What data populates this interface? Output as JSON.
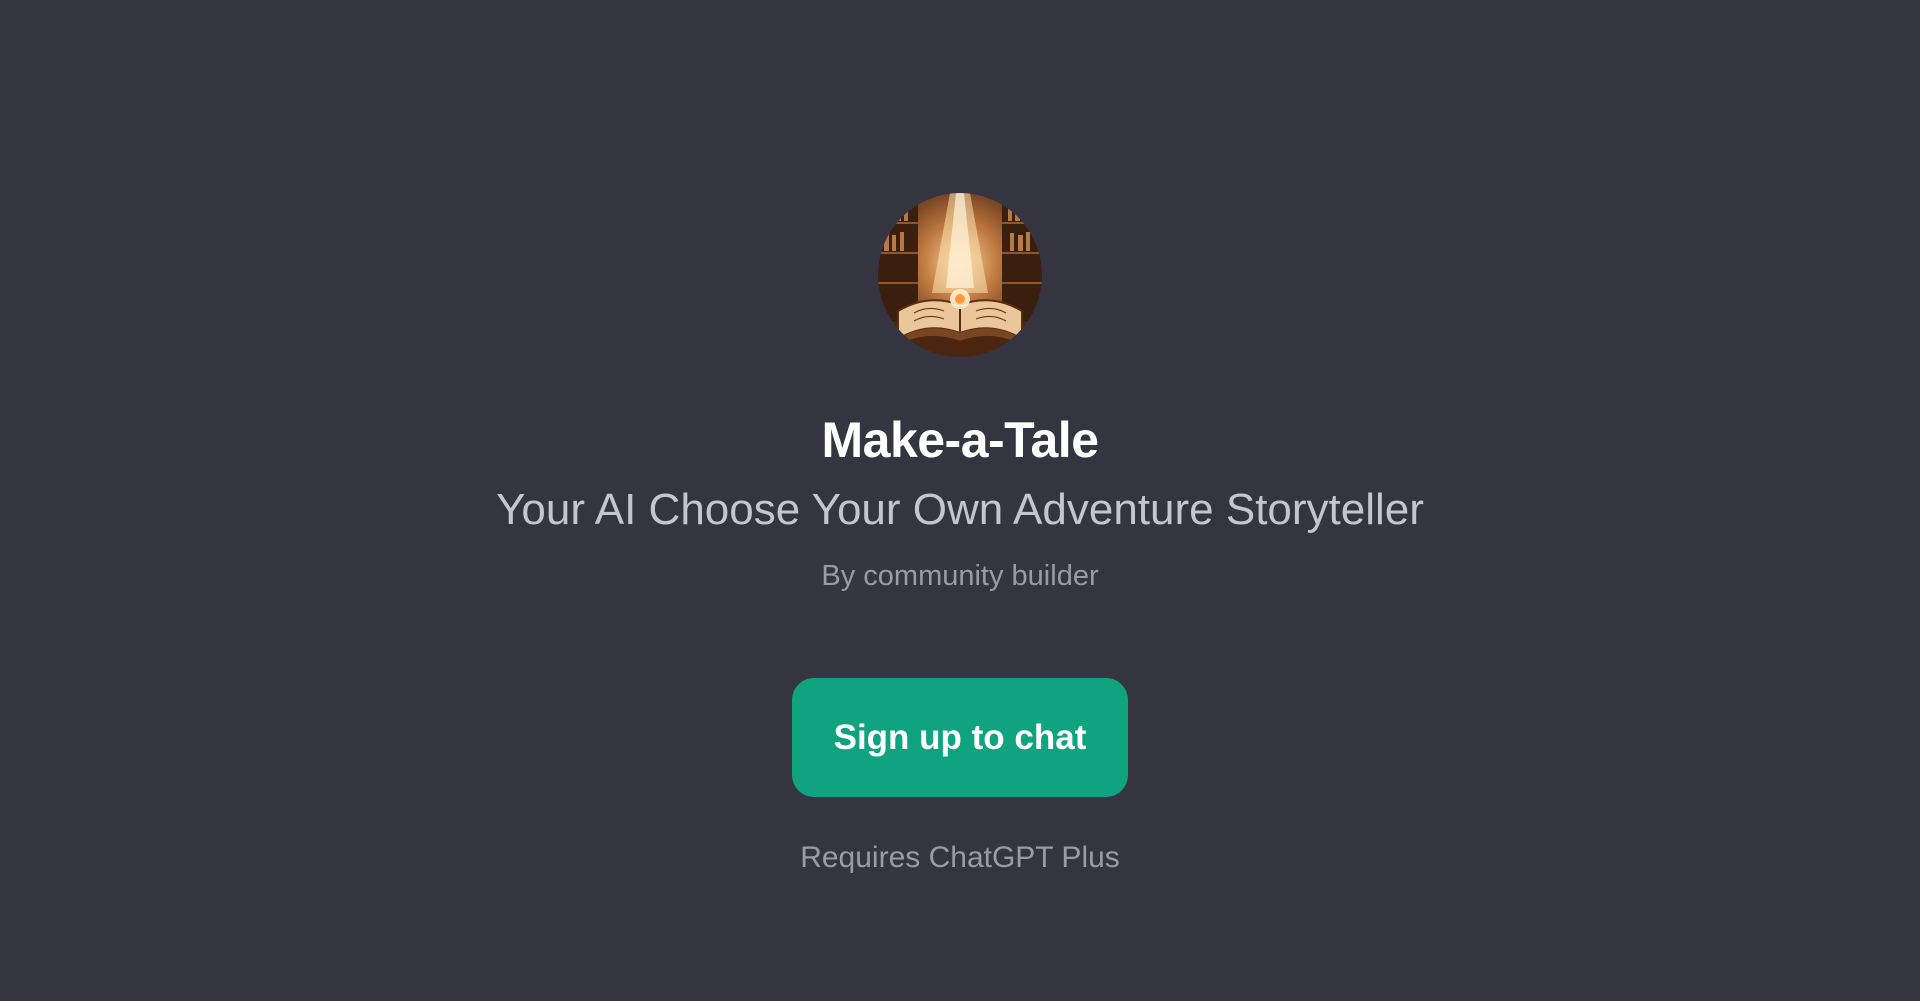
{
  "gpt": {
    "name": "Make-a-Tale",
    "description": "Your AI Choose Your Own Adventure Storyteller",
    "author": "By community builder",
    "avatar_icon": "open-book-library-icon"
  },
  "cta": {
    "signup_label": "Sign up to chat",
    "requirement": "Requires ChatGPT Plus"
  },
  "colors": {
    "background": "#343541",
    "accent": "#10a37f",
    "title": "#ffffff",
    "subtitle": "#c5c5d2",
    "muted": "#9a9aa8"
  }
}
